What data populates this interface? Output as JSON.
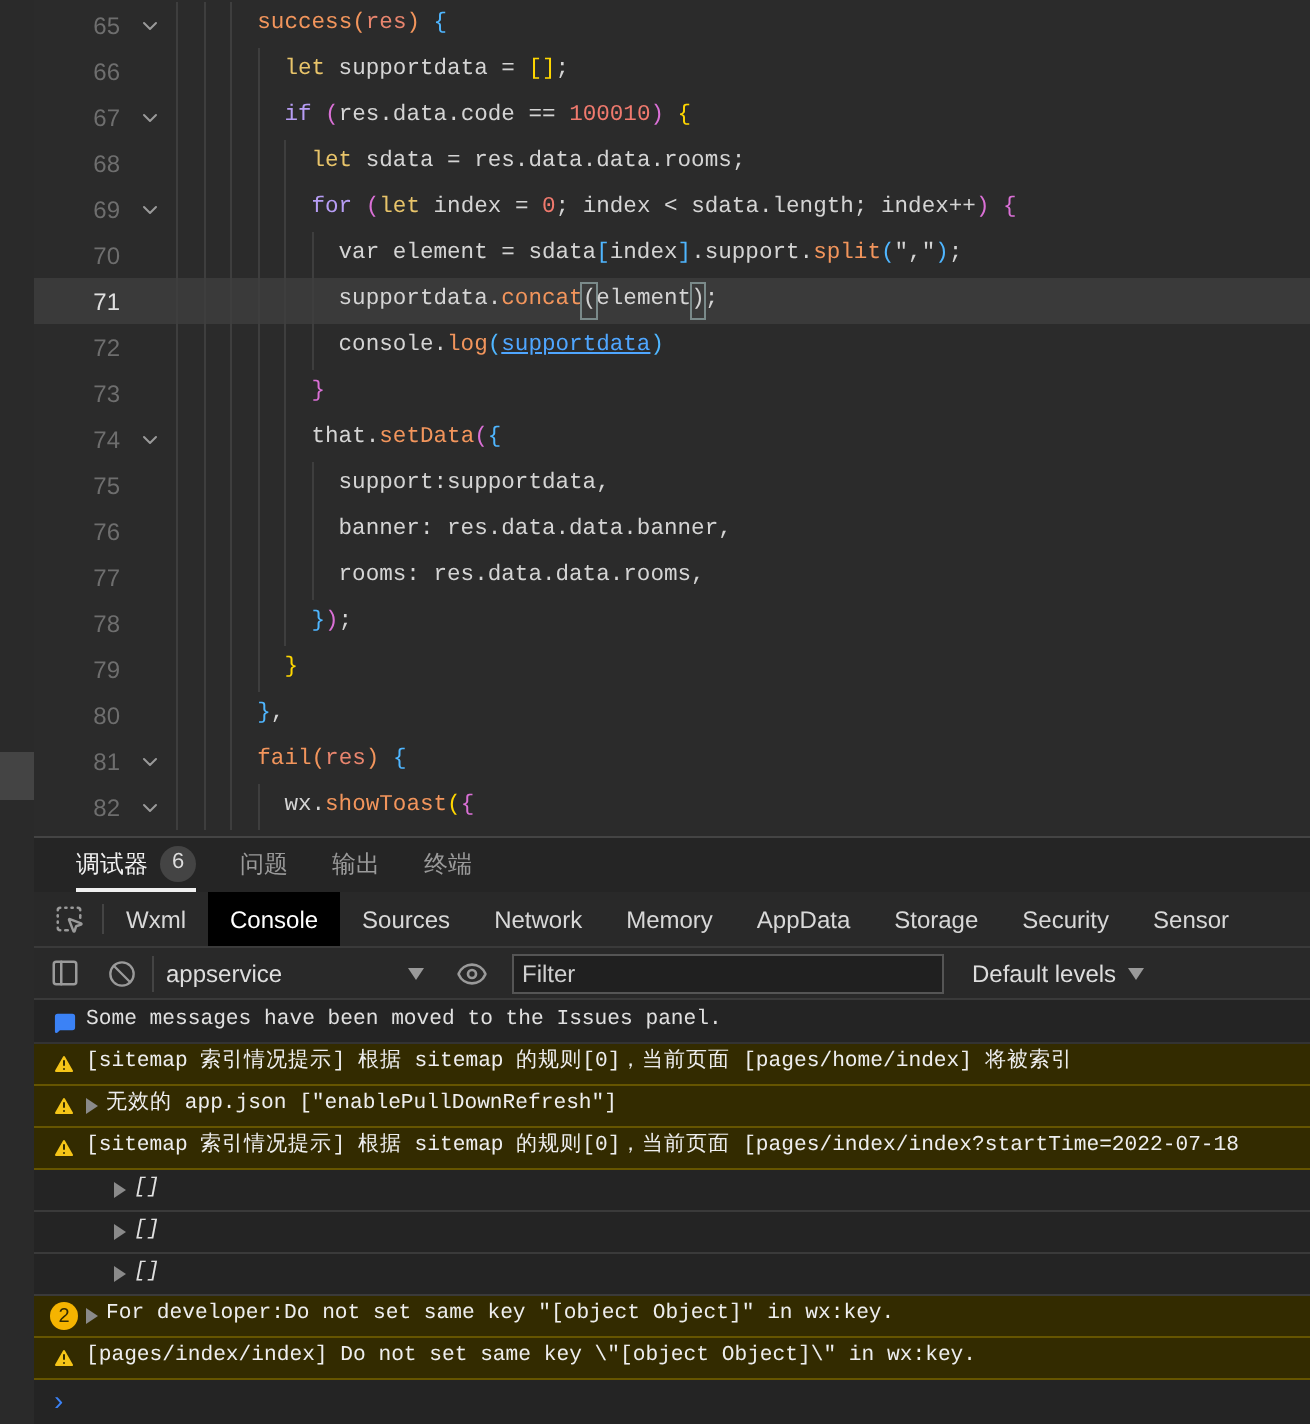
{
  "editor": {
    "lines": [
      {
        "number": "65",
        "foldable": true,
        "current": false,
        "tokens": [
          {
            "t": "      success",
            "kind": "fn"
          },
          {
            "t": "(",
            "kind": "fn"
          },
          {
            "t": "res",
            "kind": "param"
          },
          {
            "t": ")",
            "kind": "fn"
          },
          {
            "t": " {",
            "kind": "b3"
          }
        ]
      },
      {
        "number": "66",
        "foldable": false,
        "current": false,
        "tokens": [
          {
            "t": "        let",
            "kind": "decl"
          },
          {
            "t": " supportdata = ",
            "kind": "plain"
          },
          {
            "t": "[]",
            "kind": "b1"
          },
          {
            "t": ";",
            "kind": "plain"
          }
        ]
      },
      {
        "number": "67",
        "foldable": true,
        "current": false,
        "tokens": [
          {
            "t": "        if",
            "kind": "kw"
          },
          {
            "t": " (",
            "kind": "b2"
          },
          {
            "t": "res.data.code == ",
            "kind": "plain"
          },
          {
            "t": "100010",
            "kind": "num"
          },
          {
            "t": ")",
            "kind": "b2"
          },
          {
            "t": " {",
            "kind": "b1"
          }
        ]
      },
      {
        "number": "68",
        "foldable": false,
        "current": false,
        "tokens": [
          {
            "t": "          let",
            "kind": "decl"
          },
          {
            "t": " sdata = res.data.data.rooms;",
            "kind": "plain"
          }
        ]
      },
      {
        "number": "69",
        "foldable": true,
        "current": false,
        "tokens": [
          {
            "t": "          for",
            "kind": "kw"
          },
          {
            "t": " (",
            "kind": "b2"
          },
          {
            "t": "let",
            "kind": "decl"
          },
          {
            "t": " index = ",
            "kind": "plain"
          },
          {
            "t": "0",
            "kind": "num"
          },
          {
            "t": "; index < sdata.length; index++",
            "kind": "plain"
          },
          {
            "t": ")",
            "kind": "b2"
          },
          {
            "t": " {",
            "kind": "b2"
          }
        ]
      },
      {
        "number": "70",
        "foldable": false,
        "current": false,
        "tokens": [
          {
            "t": "            var element = sdata",
            "kind": "plain"
          },
          {
            "t": "[",
            "kind": "b3"
          },
          {
            "t": "index",
            "kind": "plain"
          },
          {
            "t": "]",
            "kind": "b3"
          },
          {
            "t": ".support.",
            "kind": "plain"
          },
          {
            "t": "split",
            "kind": "fn"
          },
          {
            "t": "(",
            "kind": "b3"
          },
          {
            "t": "\",\"",
            "kind": "plain"
          },
          {
            "t": ")",
            "kind": "b3"
          },
          {
            "t": ";",
            "kind": "plain"
          }
        ]
      },
      {
        "number": "71",
        "foldable": false,
        "current": true,
        "tokens": [
          {
            "t": "            supportdata.",
            "kind": "plain"
          },
          {
            "t": "concat",
            "kind": "fn"
          },
          {
            "t": "(",
            "kind": "match"
          },
          {
            "t": "element",
            "kind": "plain"
          },
          {
            "t": ")",
            "kind": "match"
          },
          {
            "t": ";",
            "kind": "plain"
          }
        ]
      },
      {
        "number": "72",
        "foldable": false,
        "current": false,
        "tokens": [
          {
            "t": "            console.",
            "kind": "plain"
          },
          {
            "t": "log",
            "kind": "fn"
          },
          {
            "t": "(",
            "kind": "b3"
          },
          {
            "t": "supportdata",
            "kind": "link"
          },
          {
            "t": ")",
            "kind": "b3"
          }
        ]
      },
      {
        "number": "73",
        "foldable": false,
        "current": false,
        "tokens": [
          {
            "t": "          }",
            "kind": "b2"
          }
        ]
      },
      {
        "number": "74",
        "foldable": true,
        "current": false,
        "tokens": [
          {
            "t": "          that.",
            "kind": "plain"
          },
          {
            "t": "setData",
            "kind": "fn"
          },
          {
            "t": "(",
            "kind": "b2"
          },
          {
            "t": "{",
            "kind": "b3"
          }
        ]
      },
      {
        "number": "75",
        "foldable": false,
        "current": false,
        "tokens": [
          {
            "t": "            support:supportdata,",
            "kind": "plain"
          }
        ]
      },
      {
        "number": "76",
        "foldable": false,
        "current": false,
        "tokens": [
          {
            "t": "            banner: res.data.data.banner,",
            "kind": "plain"
          }
        ]
      },
      {
        "number": "77",
        "foldable": false,
        "current": false,
        "tokens": [
          {
            "t": "            rooms: res.data.data.rooms,",
            "kind": "plain"
          }
        ]
      },
      {
        "number": "78",
        "foldable": false,
        "current": false,
        "tokens": [
          {
            "t": "          }",
            "kind": "b3"
          },
          {
            "t": ")",
            "kind": "b2"
          },
          {
            "t": ";",
            "kind": "plain"
          }
        ]
      },
      {
        "number": "79",
        "foldable": false,
        "current": false,
        "tokens": [
          {
            "t": "        }",
            "kind": "b1"
          }
        ]
      },
      {
        "number": "80",
        "foldable": false,
        "current": false,
        "tokens": [
          {
            "t": "      }",
            "kind": "b3"
          },
          {
            "t": ",",
            "kind": "plain"
          }
        ]
      },
      {
        "number": "81",
        "foldable": true,
        "current": false,
        "tokens": [
          {
            "t": "      fail",
            "kind": "fn"
          },
          {
            "t": "(",
            "kind": "fn"
          },
          {
            "t": "res",
            "kind": "param"
          },
          {
            "t": ")",
            "kind": "fn"
          },
          {
            "t": " {",
            "kind": "b3"
          }
        ]
      },
      {
        "number": "82",
        "foldable": true,
        "current": false,
        "tokens": [
          {
            "t": "        wx.",
            "kind": "plain"
          },
          {
            "t": "showToast",
            "kind": "fn"
          },
          {
            "t": "(",
            "kind": "b1"
          },
          {
            "t": "{",
            "kind": "b2"
          }
        ]
      }
    ]
  },
  "panel_tabs": [
    {
      "label": "调试器",
      "badge": "6",
      "selected": true
    },
    {
      "label": "问题",
      "selected": false
    },
    {
      "label": "输出",
      "selected": false
    },
    {
      "label": "终端",
      "selected": false
    }
  ],
  "devtools_tabs": [
    {
      "label": "Wxml",
      "selected": false
    },
    {
      "label": "Console",
      "selected": true
    },
    {
      "label": "Sources",
      "selected": false
    },
    {
      "label": "Network",
      "selected": false
    },
    {
      "label": "Memory",
      "selected": false
    },
    {
      "label": "AppData",
      "selected": false
    },
    {
      "label": "Storage",
      "selected": false
    },
    {
      "label": "Security",
      "selected": false
    },
    {
      "label": "Sensor",
      "selected": false
    }
  ],
  "toolbar": {
    "context": "appservice",
    "filter": {
      "placeholder": "Filter"
    },
    "levels": "Default levels"
  },
  "messages": [
    {
      "kind": "info",
      "expandable": false,
      "text": "Some messages have been moved to the Issues panel."
    },
    {
      "kind": "warning",
      "expandable": false,
      "text": "[sitemap 索引情况提示] 根据 sitemap 的规则[0]，当前页面 [pages/home/index] 将被索引"
    },
    {
      "kind": "warning",
      "expandable": true,
      "text": "无效的 app.json [\"enablePullDownRefresh\"]"
    },
    {
      "kind": "warning",
      "expandable": false,
      "text": "[sitemap 索引情况提示] 根据 sitemap 的规则[0]，当前页面 [pages/index/index?startTime=2022-07-18"
    },
    {
      "kind": "log",
      "expandable": true,
      "text": "[]"
    },
    {
      "kind": "log",
      "expandable": true,
      "text": "[]"
    },
    {
      "kind": "log",
      "expandable": true,
      "text": "[]"
    },
    {
      "kind": "warning",
      "expandable": true,
      "count": "2",
      "text": "For developer:Do not set same key \"[object Object]\" in wx:key."
    },
    {
      "kind": "warning",
      "expandable": false,
      "text": "[pages/index/index] Do not set same key \\\"[object Object]\\\" in wx:key."
    }
  ],
  "prompt": "›"
}
